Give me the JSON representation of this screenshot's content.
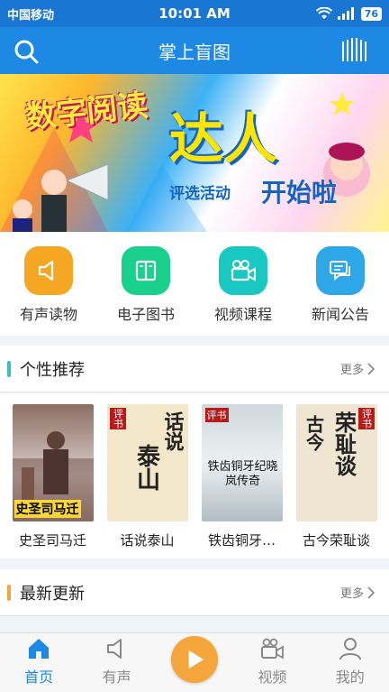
{
  "status_bar": {
    "carrier": "中国移动",
    "time": "10:01 AM",
    "battery": "76"
  },
  "header": {
    "title": "掌上盲图"
  },
  "banner": {
    "line1": "数字阅读",
    "line2": "达人",
    "line3": "评选活动",
    "line4": "开始啦"
  },
  "quick_nav": [
    {
      "label": "有声读物",
      "icon": "speaker-icon",
      "color": "#f5a623"
    },
    {
      "label": "电子图书",
      "icon": "book-icon",
      "color": "#19d18c"
    },
    {
      "label": "视频课程",
      "icon": "video-camera-icon",
      "color": "#19c9c1"
    },
    {
      "label": "新闻公告",
      "icon": "chat-icon",
      "color": "#2ea7e8"
    }
  ],
  "recommend": {
    "title": "个性推荐",
    "more": "更多",
    "books": [
      {
        "title": "史圣司马迁",
        "cover_text": "史圣司马迁"
      },
      {
        "title": "话说泰山",
        "cover_text_a": "话说",
        "cover_text_b": "泰山",
        "badge": "评书"
      },
      {
        "title": "铁齿铜牙…",
        "cover_text": "铁齿铜牙纪晓岚传奇",
        "badge": "评书"
      },
      {
        "title": "古今荣耻谈",
        "cover_text_a": "古今",
        "cover_text_b": "荣耻谈",
        "badge": "评书"
      }
    ]
  },
  "latest": {
    "title": "最新更新",
    "more": "更多"
  },
  "bottom_nav": [
    {
      "label": "首页",
      "active": true
    },
    {
      "label": "有声",
      "active": false
    },
    {
      "label": "视频",
      "active": false
    },
    {
      "label": "我的",
      "active": false
    }
  ],
  "colors": {
    "primary": "#1e88e5",
    "accent_orange": "#f4a63a",
    "section_bar_teal": "#33c3b7",
    "section_bar_orange": "#f4a63a"
  }
}
